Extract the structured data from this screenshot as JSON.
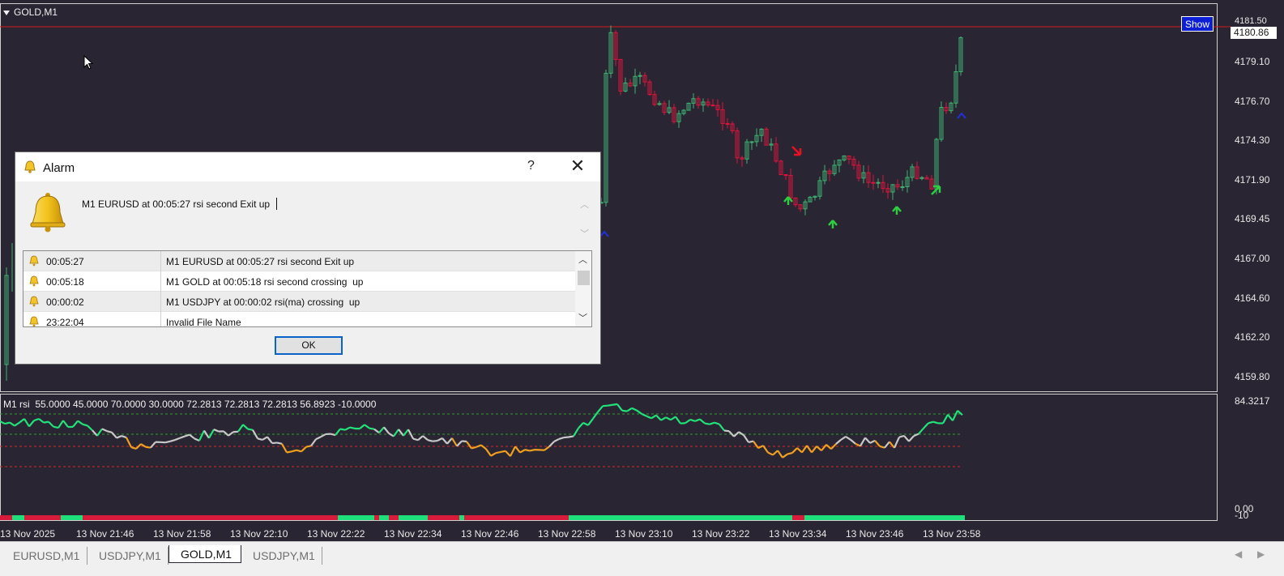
{
  "chart": {
    "symbol": "GOLD,M1",
    "show_button": "Show",
    "current_price": "4180.86",
    "price_top_partial": "4181.50",
    "price_ticks": [
      "4179.10",
      "4176.70",
      "4174.30",
      "4171.90",
      "4169.45",
      "4167.00",
      "4164.60",
      "4162.20",
      "4159.80"
    ],
    "indicator_label": "M1 rsi  55.0000 45.0000 70.0000 30.0000 72.2813 72.2813 72.2813 56.8923 -10.0000",
    "indicator_max": "84.3217",
    "indicator_zero": "0.00",
    "indicator_min": "-10",
    "time_ticks": [
      "13 Nov 2025",
      "13 Nov 21:46",
      "13 Nov 21:58",
      "13 Nov 22:10",
      "13 Nov 22:22",
      "13 Nov 22:34",
      "13 Nov 22:46",
      "13 Nov 22:58",
      "13 Nov 23:10",
      "13 Nov 23:22",
      "13 Nov 23:34",
      "13 Nov 23:46",
      "13 Nov 23:58"
    ],
    "colors": {
      "background": "#2a2532",
      "bull": "#3cb371",
      "bear": "#dc143c",
      "price_line": "#d31b1b",
      "rsi_up": "#22e27a",
      "rsi_down": "#f0a020",
      "rsi_neutral": "#c8c8c8"
    }
  },
  "tabs": [
    {
      "label": "EURUSD,M1",
      "active": false
    },
    {
      "label": "USDJPY,M1",
      "active": false
    },
    {
      "label": "GOLD,M1",
      "active": true
    },
    {
      "label": "USDJPY,M1",
      "active": false
    }
  ],
  "dialog": {
    "title": "Alarm",
    "help": "?",
    "close": "✕",
    "message": "M1 EURUSD at 00:05:27 rsi second Exit up",
    "log": [
      {
        "time": "00:05:27",
        "message": "M1 EURUSD at 00:05:27 rsi second Exit up"
      },
      {
        "time": "00:05:18",
        "message": "M1 GOLD at 00:05:18 rsi second crossing  up"
      },
      {
        "time": "00:00:02",
        "message": "M1 USDJPY at 00:00:02 rsi(ma) crossing  up"
      },
      {
        "time": "23:22:04",
        "message": "Invalid File Name"
      }
    ],
    "ok_label": "OK"
  }
}
